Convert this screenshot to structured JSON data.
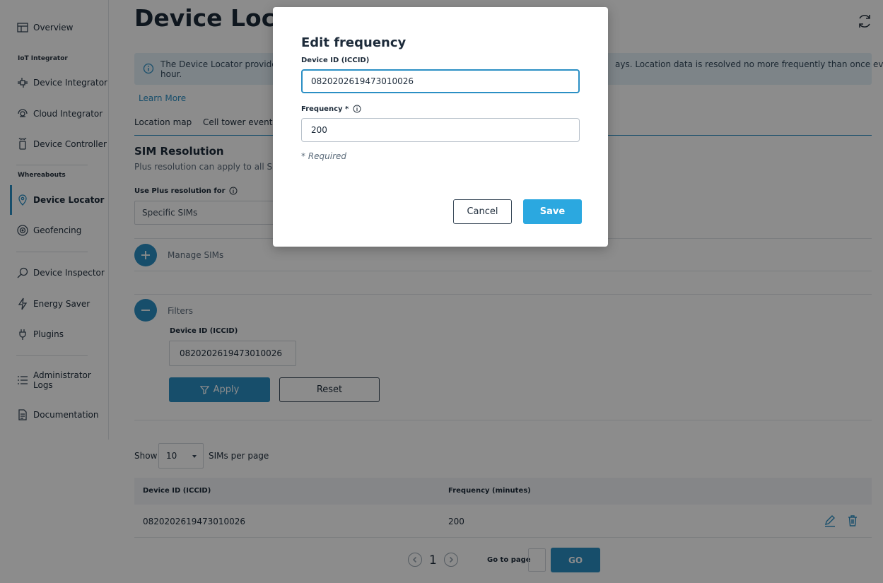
{
  "sidebar": {
    "items": [
      {
        "label": "Overview",
        "icon": "layout-icon"
      },
      {
        "label": "Device Integrator",
        "icon": "integrator-icon"
      },
      {
        "label": "Cloud Integrator",
        "icon": "cloud-icon"
      },
      {
        "label": "Device Controller",
        "icon": "controller-icon"
      },
      {
        "label": "Device Locator",
        "icon": "map-pin-icon"
      },
      {
        "label": "Geofencing",
        "icon": "geofence-icon"
      },
      {
        "label": "Device Inspector",
        "icon": "search-icon"
      },
      {
        "label": "Energy Saver",
        "icon": "lightning-icon"
      },
      {
        "label": "Plugins",
        "icon": "plug-icon"
      },
      {
        "label": "Administrator Logs",
        "icon": "list-icon"
      },
      {
        "label": "Documentation",
        "icon": "document-icon"
      }
    ],
    "sections": [
      "IoT Integrator",
      "Whereabouts"
    ]
  },
  "page": {
    "title": "Device Locator",
    "info_text_part1": "The Device Locator provides ce",
    "info_text_part2": "ays. Location data is resolved no more frequently than once every",
    "info_text_part3": "hour.",
    "learn_more": "Learn More",
    "tabs": [
      "Location map",
      "Cell tower events"
    ]
  },
  "sim_resolution": {
    "title": "SIM Resolution",
    "subtitle": "Plus resolution can apply to all SIMs o",
    "use_plus_label": "Use Plus resolution for",
    "select_value": "Specific SIMs",
    "manage_sims": "Manage SIMs",
    "filters": "Filters"
  },
  "filters": {
    "device_id_label": "Device ID (ICCID)",
    "device_id_value": "0820202619473010026",
    "apply": "Apply",
    "reset": "Reset"
  },
  "pagination": {
    "show": "Show",
    "page_size": "10",
    "per_page": "SIMs per page",
    "current_page": "1",
    "goto_label": "Go to page",
    "go": "GO"
  },
  "table": {
    "columns": [
      "Device ID (ICCID)",
      "Frequency (minutes)"
    ],
    "rows": [
      {
        "device_id": "0820202619473010026",
        "frequency": "200"
      }
    ]
  },
  "modal": {
    "title": "Edit frequency",
    "device_id_label": "Device ID (ICCID)",
    "device_id_value": "0820202619473010026",
    "frequency_label": "Frequency *",
    "frequency_value": "200",
    "required_note": "* Required",
    "cancel": "Cancel",
    "save": "Save"
  },
  "colors": {
    "accent": "#2b8fc4",
    "save": "#2ba8e0",
    "banner": "#e3f0f8"
  }
}
